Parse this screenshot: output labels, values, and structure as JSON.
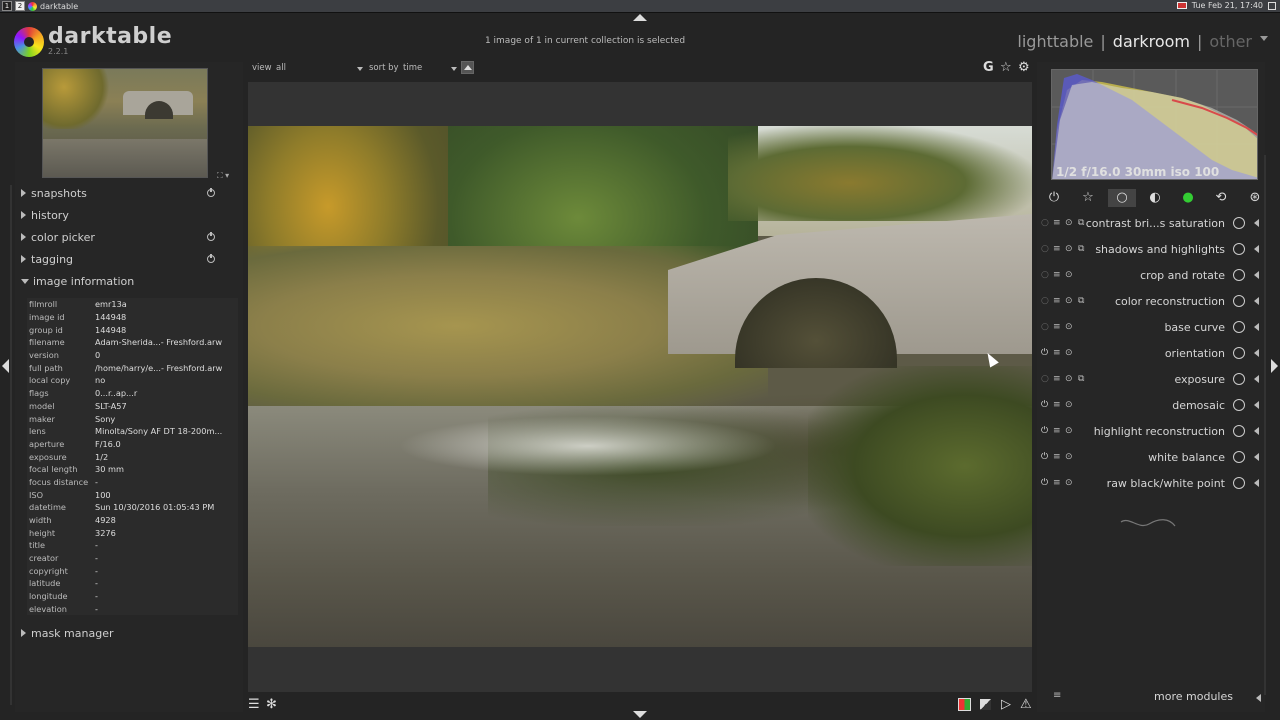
{
  "taskbar": {
    "workspaces": [
      "1",
      "2"
    ],
    "app_title": "darktable",
    "clock": "Tue Feb 21, 17:40"
  },
  "header": {
    "app_name": "darktable",
    "version": "2.2.1",
    "status": "1 image of 1 in current collection is selected",
    "views": [
      "lighttable",
      "|",
      "darkroom",
      "|",
      "other"
    ],
    "active_view": "darkroom"
  },
  "top_toolbar": {
    "view_label": "view",
    "view_value": "all",
    "sort_label": "sort by",
    "sort_value": "time",
    "icons": [
      "G",
      "☆",
      "⚙"
    ]
  },
  "left_panel": {
    "sections": [
      {
        "label": "snapshots",
        "open": false,
        "reset": true
      },
      {
        "label": "history",
        "open": false,
        "reset": false
      },
      {
        "label": "color picker",
        "open": false,
        "reset": true
      },
      {
        "label": "tagging",
        "open": false,
        "reset": true
      },
      {
        "label": "image information",
        "open": true,
        "reset": false
      }
    ],
    "image_information": [
      [
        "filmroll",
        "emr13a"
      ],
      [
        "image id",
        "144948"
      ],
      [
        "group id",
        "144948"
      ],
      [
        "filename",
        "Adam-Sherida...- Freshford.arw"
      ],
      [
        "version",
        "0"
      ],
      [
        "full path",
        "/home/harry/e...- Freshford.arw"
      ],
      [
        "local copy",
        "no"
      ],
      [
        "flags",
        "0...r..ap...r"
      ],
      [
        "model",
        "SLT-A57"
      ],
      [
        "maker",
        "Sony"
      ],
      [
        "lens",
        "Minolta/Sony AF DT 18-200m..."
      ],
      [
        "aperture",
        "F/16.0"
      ],
      [
        "exposure",
        "1/2"
      ],
      [
        "focal length",
        "30 mm"
      ],
      [
        "focus distance",
        "-"
      ],
      [
        "ISO",
        "100"
      ],
      [
        "datetime",
        "Sun 10/30/2016 01:05:43 PM"
      ],
      [
        "width",
        "4928"
      ],
      [
        "height",
        "3276"
      ],
      [
        "title",
        "-"
      ],
      [
        "creator",
        "-"
      ],
      [
        "copyright",
        "-"
      ],
      [
        "latitude",
        "-"
      ],
      [
        "longitude",
        "-"
      ],
      [
        "elevation",
        "-"
      ]
    ],
    "mask_manager": "mask manager"
  },
  "histogram": {
    "info": "1/2 f/16.0 30mm iso 100"
  },
  "modules": [
    {
      "name": "contrast bri...s saturation",
      "icon": "contrast-icon",
      "power": false
    },
    {
      "name": "shadows and highlights",
      "icon": "shadows-icon",
      "power": false
    },
    {
      "name": "crop and rotate",
      "icon": "crop-icon",
      "power": false
    },
    {
      "name": "color reconstruction",
      "icon": "color-reconstruction-icon",
      "power": false
    },
    {
      "name": "base curve",
      "icon": "base-curve-icon",
      "power": false
    },
    {
      "name": "orientation",
      "icon": "orientation-icon",
      "power": true
    },
    {
      "name": "exposure",
      "icon": "exposure-icon",
      "power": false
    },
    {
      "name": "demosaic",
      "icon": "demosaic-icon",
      "power": true
    },
    {
      "name": "highlight reconstruction",
      "icon": "highlight-icon",
      "power": true
    },
    {
      "name": "white balance",
      "icon": "white-balance-icon",
      "power": true
    },
    {
      "name": "raw black/white point",
      "icon": "raw-bw-icon",
      "power": true
    }
  ],
  "more_modules": "more modules"
}
